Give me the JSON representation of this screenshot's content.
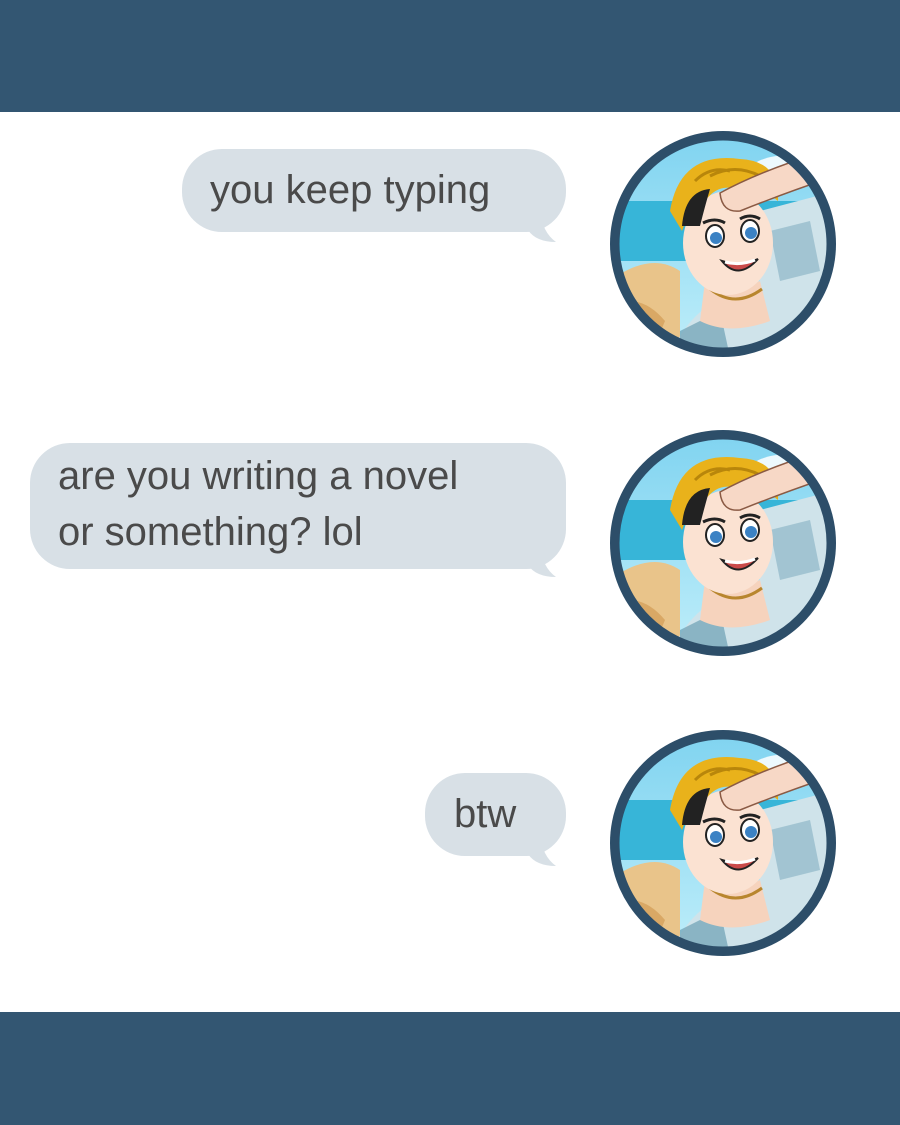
{
  "colors": {
    "header_bar": "#335672",
    "footer_bar": "#335672",
    "bubble_bg": "#d8e0e6",
    "bubble_text": "#4a4a4a",
    "avatar_ring": "#2d4e69"
  },
  "conversation": {
    "messages": [
      {
        "text": "you keep typing",
        "avatar": "avatar-anime-boy-saluting-icon"
      },
      {
        "text": "are you writing a novel\nor something? lol",
        "avatar": "avatar-anime-boy-saluting-icon"
      },
      {
        "text": "btw",
        "avatar": "avatar-anime-boy-saluting-icon"
      }
    ]
  }
}
